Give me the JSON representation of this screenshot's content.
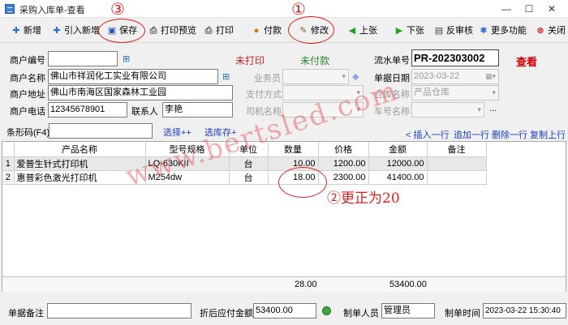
{
  "window": {
    "title": "采购入库单-查看",
    "minimize": "—",
    "maximize": "☐",
    "close": "✕"
  },
  "toolbar": {
    "new": "新增",
    "import_new": "引入新增",
    "save": "保存",
    "print_preview": "打印预览",
    "print": "打印",
    "pay": "付款",
    "modify": "修改",
    "prev": "上张",
    "next": "下张",
    "unaudit": "反审核",
    "more": "更多功能",
    "close": "关闭"
  },
  "annotations": {
    "one": "①",
    "three": "③",
    "two_text": "②更正为20",
    "watermark": "www.bertsled.com"
  },
  "header": {
    "customer_code_label": "商户编号",
    "customer_code": "",
    "customer_name_label": "商户名称",
    "customer_name": "佛山市祥润化工实业有限公司",
    "customer_addr_label": "商户地址",
    "customer_addr": "佛山市南海区国家森林工业园",
    "customer_phone_label": "商户电话",
    "customer_phone": "12345678901",
    "contact_label": "联系人",
    "contact": "李艳",
    "print_status": "未打印",
    "pay_status": "未付款",
    "salesman_label": "业务员",
    "pay_method_label": "支付方式",
    "driver_label": "司机名称",
    "serial_label": "流水单号",
    "serial": "PR-202303002",
    "view_mode": "查看",
    "date_label": "单据日期",
    "date": "2023-03-22",
    "warehouse_label": "仓库名称",
    "warehouse": "产品仓库",
    "plate_label": "车号名称",
    "more_dots": "..."
  },
  "barcode": {
    "label": "条形码(F4)",
    "value": "",
    "select_add": "选择++",
    "select_save": "选库存+",
    "insert_row": "< 插入一行",
    "append_row": "追加一行",
    "delete_row": "删除一行",
    "copy_row": "复制上行"
  },
  "grid": {
    "columns": [
      "",
      "产品名称",
      "型号规格",
      "单位",
      "数量",
      "价格",
      "金额",
      "备注"
    ],
    "rows": [
      {
        "no": "1",
        "name": "爱普生针式打印机",
        "model": "LQ-630KII",
        "unit": "台",
        "qty": "10.00",
        "price": "1200.00",
        "amount": "12000.00",
        "note": ""
      },
      {
        "no": "2",
        "name": "惠普彩色激光打印机",
        "model": "M254dw",
        "unit": "台",
        "qty": "18.00",
        "price": "2300.00",
        "amount": "41400.00",
        "note": ""
      }
    ],
    "total_qty": "28.00",
    "total_amount": "53400.00"
  },
  "footer": {
    "note_label": "单据备注",
    "note": "",
    "payable_label": "折后应付金额",
    "payable": "53400.00",
    "maker_label": "制单人员",
    "maker": "管理员",
    "time_label": "制单时间",
    "time": "2023-03-22 15:30:40"
  },
  "colors": {
    "annotation_red": "#e02020",
    "link_blue": "#1a3ec8",
    "status_green": "#2a8a2a"
  }
}
